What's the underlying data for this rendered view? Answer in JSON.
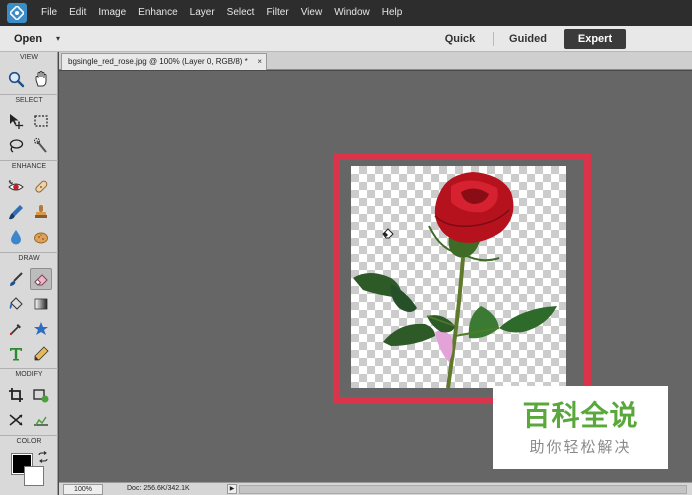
{
  "menubar": {
    "items": [
      "File",
      "Edit",
      "Image",
      "Enhance",
      "Layer",
      "Select",
      "Filter",
      "View",
      "Window",
      "Help"
    ]
  },
  "modebar": {
    "open_label": "Open",
    "open_caret": "▾",
    "modes": [
      "Quick",
      "Guided",
      "Expert"
    ],
    "active_mode": "Expert"
  },
  "toolpanel": {
    "sections": [
      "VIEW",
      "SELECT",
      "ENHANCE",
      "DRAW",
      "MODIFY",
      "COLOR"
    ],
    "tools": [
      {
        "name": "zoom-tool-icon",
        "section": "VIEW"
      },
      {
        "name": "hand-tool-icon",
        "section": "VIEW"
      },
      {
        "name": "move-tool-icon",
        "section": "SELECT"
      },
      {
        "name": "rectangular-marquee-icon",
        "section": "SELECT"
      },
      {
        "name": "lasso-tool-icon",
        "section": "SELECT"
      },
      {
        "name": "quick-selection-icon",
        "section": "SELECT"
      },
      {
        "name": "red-eye-icon",
        "section": "ENHANCE"
      },
      {
        "name": "spot-healing-icon",
        "section": "ENHANCE"
      },
      {
        "name": "smart-brush-icon",
        "section": "ENHANCE"
      },
      {
        "name": "clone-stamp-icon",
        "section": "ENHANCE"
      },
      {
        "name": "blur-tool-icon",
        "section": "ENHANCE"
      },
      {
        "name": "sponge-tool-icon",
        "section": "ENHANCE"
      },
      {
        "name": "brush-tool-icon",
        "section": "DRAW"
      },
      {
        "name": "eraser-tool-icon",
        "section": "DRAW",
        "active": true
      },
      {
        "name": "paint-bucket-icon",
        "section": "DRAW"
      },
      {
        "name": "gradient-tool-icon",
        "section": "DRAW"
      },
      {
        "name": "eyedropper-icon",
        "section": "DRAW"
      },
      {
        "name": "custom-shape-icon",
        "section": "DRAW"
      },
      {
        "name": "type-tool-icon",
        "section": "DRAW"
      },
      {
        "name": "pencil-tool-icon",
        "section": "DRAW"
      },
      {
        "name": "crop-tool-icon",
        "section": "MODIFY"
      },
      {
        "name": "recompose-tool-icon",
        "section": "MODIFY"
      },
      {
        "name": "content-aware-move-icon",
        "section": "MODIFY"
      },
      {
        "name": "straighten-tool-icon",
        "section": "MODIFY"
      }
    ],
    "colors": {
      "foreground": "#000000",
      "background": "#ffffff"
    }
  },
  "document": {
    "tab_label": "bgsingle_red_rose.jpg @ 100% (Layer 0, RGB/8) *",
    "close_glyph": "×"
  },
  "statusbar": {
    "zoom": "100%",
    "doc_size": "Doc: 256.6K/342.1K",
    "arrow_glyph": "▶"
  },
  "watermark": {
    "main": "百科全说",
    "sub": "助你轻松解决"
  },
  "colors": {
    "highlight": "#d9344a",
    "canvas_bg": "#666666",
    "watermark_green": "#5aa83c"
  }
}
